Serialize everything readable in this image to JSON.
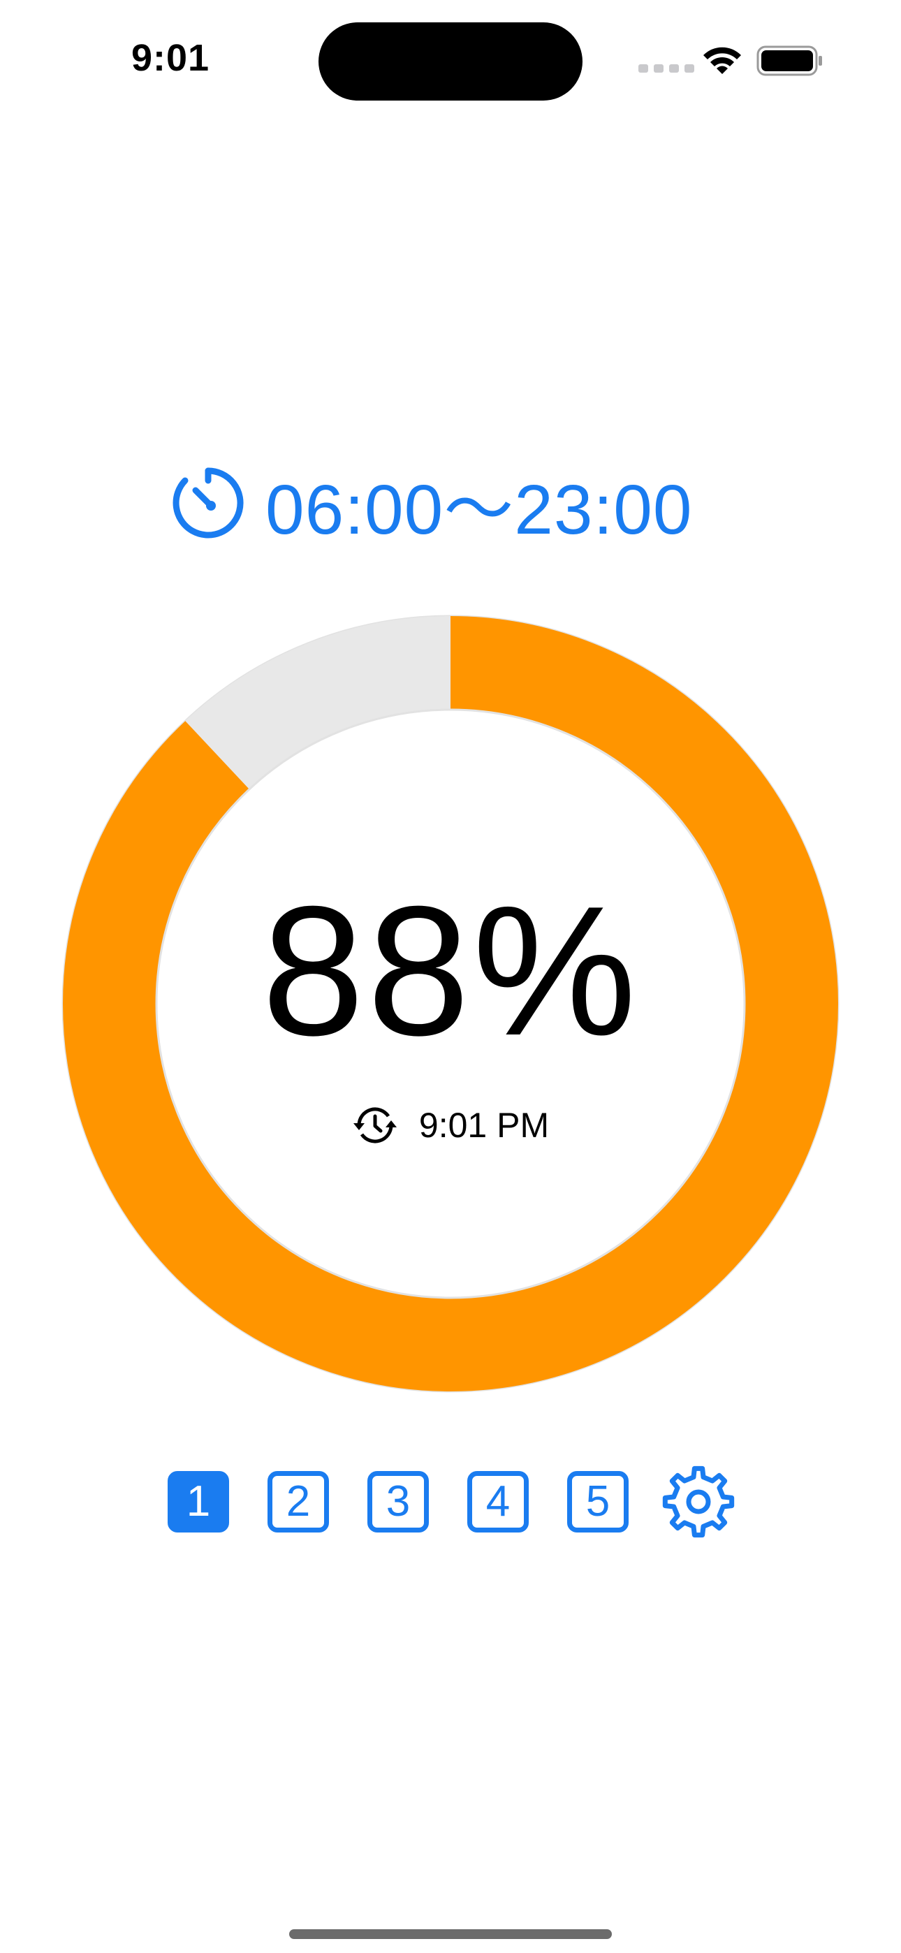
{
  "status_bar": {
    "time": "9:01",
    "wifi_icon": "wifi-icon",
    "battery_icon": "battery-icon"
  },
  "schedule": {
    "icon": "timer-icon",
    "range": "06:00～23:00"
  },
  "progress": {
    "percent_label": "88%",
    "value": 0.88,
    "fill_color": "#FF9500",
    "track_color": "#E8E8E8",
    "updated_icon": "clock-history-icon",
    "updated_time": "9:01 PM"
  },
  "selector": {
    "slots": [
      "1",
      "2",
      "3",
      "4",
      "5"
    ],
    "active_index": 0,
    "settings_icon": "gear-icon",
    "accent": "#1A7CF0"
  }
}
